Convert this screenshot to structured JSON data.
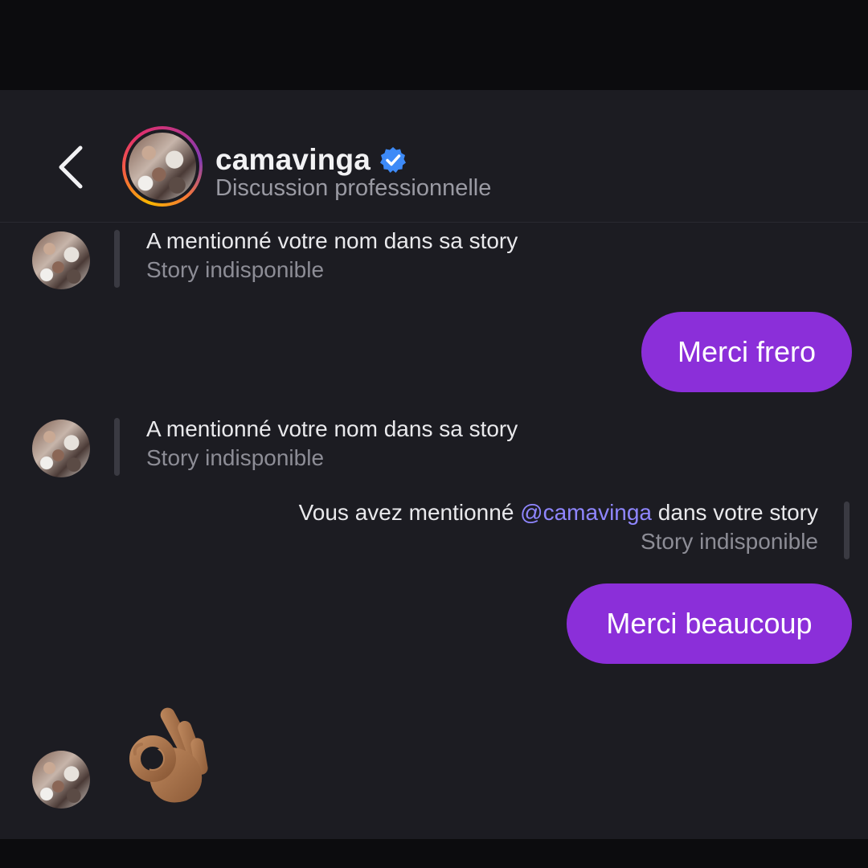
{
  "header": {
    "username": "camavinga",
    "subtitle": "Discussion professionnelle",
    "back_icon": "chevron-left-icon",
    "verified_icon": "verified-badge-icon"
  },
  "messages": [
    {
      "type": "story_mention_received",
      "line1": "A mentionné votre nom dans sa story",
      "line2": "Story indisponible"
    },
    {
      "type": "sent_text",
      "text": "Merci frero"
    },
    {
      "type": "story_mention_received",
      "line1": "A mentionné votre nom dans sa story",
      "line2": "Story indisponible"
    },
    {
      "type": "story_mention_sent",
      "prefix": "Vous avez mentionné ",
      "mention": "@camavinga",
      "suffix": " dans votre story",
      "line2": "Story indisponible"
    },
    {
      "type": "sent_text",
      "text": "Merci beaucoup"
    },
    {
      "type": "received_emoji",
      "emoji": "ok-hand-medium-dark-skin-icon"
    }
  ],
  "colors": {
    "background": "#1c1c22",
    "sent_bubble": "#8b2fd9",
    "mention": "#8f86ff",
    "verified": "#3d8af7"
  }
}
